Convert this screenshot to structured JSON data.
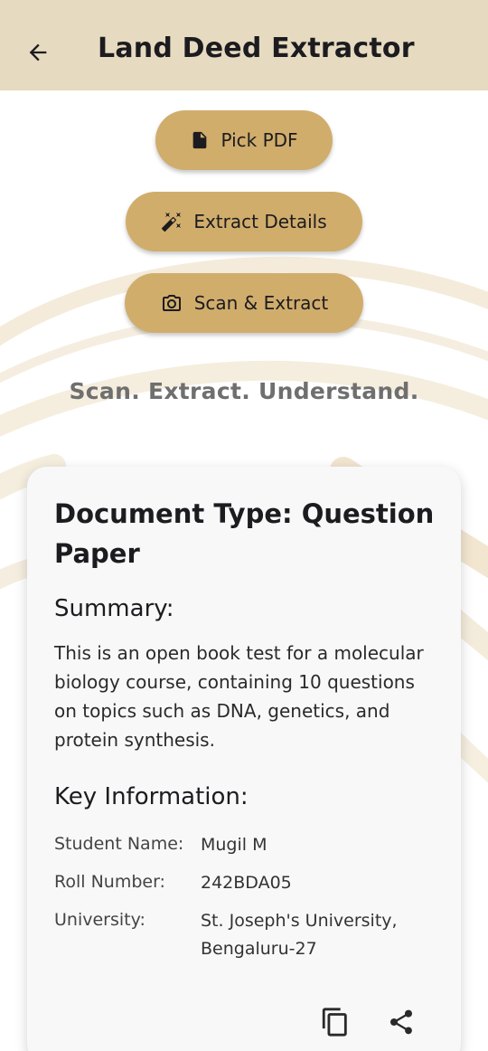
{
  "appbar": {
    "title": "Land Deed Extractor",
    "back_icon": "arrow-back-icon"
  },
  "actions": {
    "pick_pdf": {
      "label": "Pick PDF",
      "icon": "upload-file-icon"
    },
    "extract": {
      "label": "Extract Details",
      "icon": "magic-wand-icon"
    },
    "scan": {
      "label": "Scan & Extract",
      "icon": "camera-icon"
    }
  },
  "tagline": "Scan. Extract. Understand.",
  "result": {
    "document_type": "Document Type: Question Paper",
    "summary_heading": "Summary:",
    "summary_text": "This is an open book test for a molecular biology course, containing 10 questions on topics such as DNA, genetics, and protein synthesis.",
    "key_heading": "Key Information:",
    "key_info": [
      {
        "label": "Student Name:",
        "value": "Mugil M"
      },
      {
        "label": "Roll Number:",
        "value": "242BDA05"
      },
      {
        "label": "University:",
        "value": "St. Joseph's University, Bengaluru-27"
      }
    ],
    "copy_icon": "copy-icon",
    "share_icon": "share-icon"
  },
  "colors": {
    "appbar_bg": "#e6dac0",
    "button_bg": "#d1ad6c",
    "tagline": "#6f6f6f",
    "card_bg": "#f8f8f8"
  }
}
